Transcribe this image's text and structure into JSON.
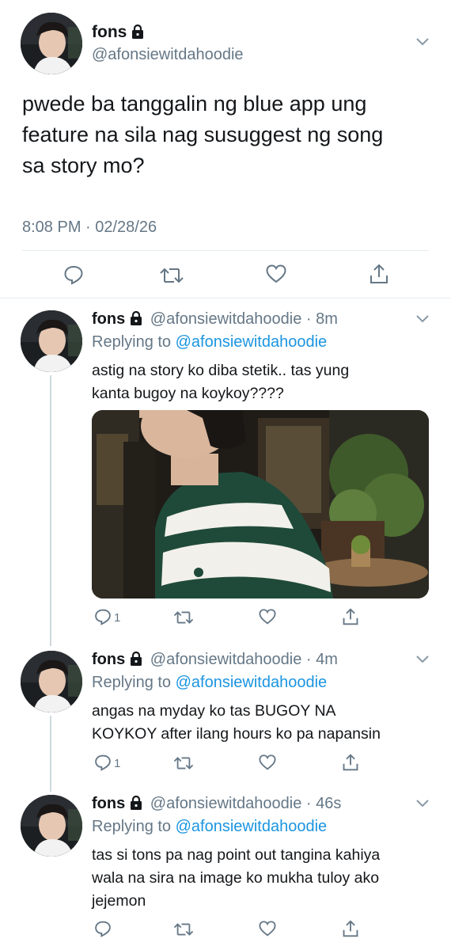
{
  "main_tweet": {
    "display_name": "fons",
    "handle": "@afonsiewitdahoodie",
    "text_line1": "pwede ba tanggalin ng blue app ung",
    "text_line2": "feature na sila nag susuggest ng song",
    "text_line3": "sa story mo?",
    "timestamp": "8:08 PM · 02/28/26"
  },
  "replies": [
    {
      "display_name": "fons",
      "handle": "@afonsiewitdahoodie",
      "age": "8m",
      "replying_prefix": "Replying to",
      "replying_handle": "@afonsiewitdahoodie",
      "text_line1": "astig na story ko diba stetik.. tas yung",
      "text_line2": "kanta bugoy na koykoy????",
      "reply_count": "1"
    },
    {
      "display_name": "fons",
      "handle": "@afonsiewitdahoodie",
      "age": "4m",
      "replying_prefix": "Replying to",
      "replying_handle": "@afonsiewitdahoodie",
      "text_line1": "angas na myday ko tas BUGOY NA",
      "text_line2": "KOYKOY after ilang hours ko pa napansin",
      "reply_count": "1"
    },
    {
      "display_name": "fons",
      "handle": "@afonsiewitdahoodie",
      "age": "46s",
      "replying_prefix": "Replying to",
      "replying_handle": "@afonsiewitdahoodie",
      "text_line1": "tas si tons pa nag point out tangina kahiya",
      "text_line2": "wala na sira na image ko mukha tuloy ako",
      "text_line3": "jejemon"
    }
  ],
  "icons": {
    "reply": "reply-icon",
    "retweet": "retweet-icon",
    "like": "heart-icon",
    "share": "share-icon",
    "more": "chevron-down-icon",
    "protected": "lock-icon"
  },
  "colors": {
    "text": "#14171a",
    "secondary": "#657786",
    "link": "#1b95e0",
    "divider": "#e6ecf0"
  }
}
